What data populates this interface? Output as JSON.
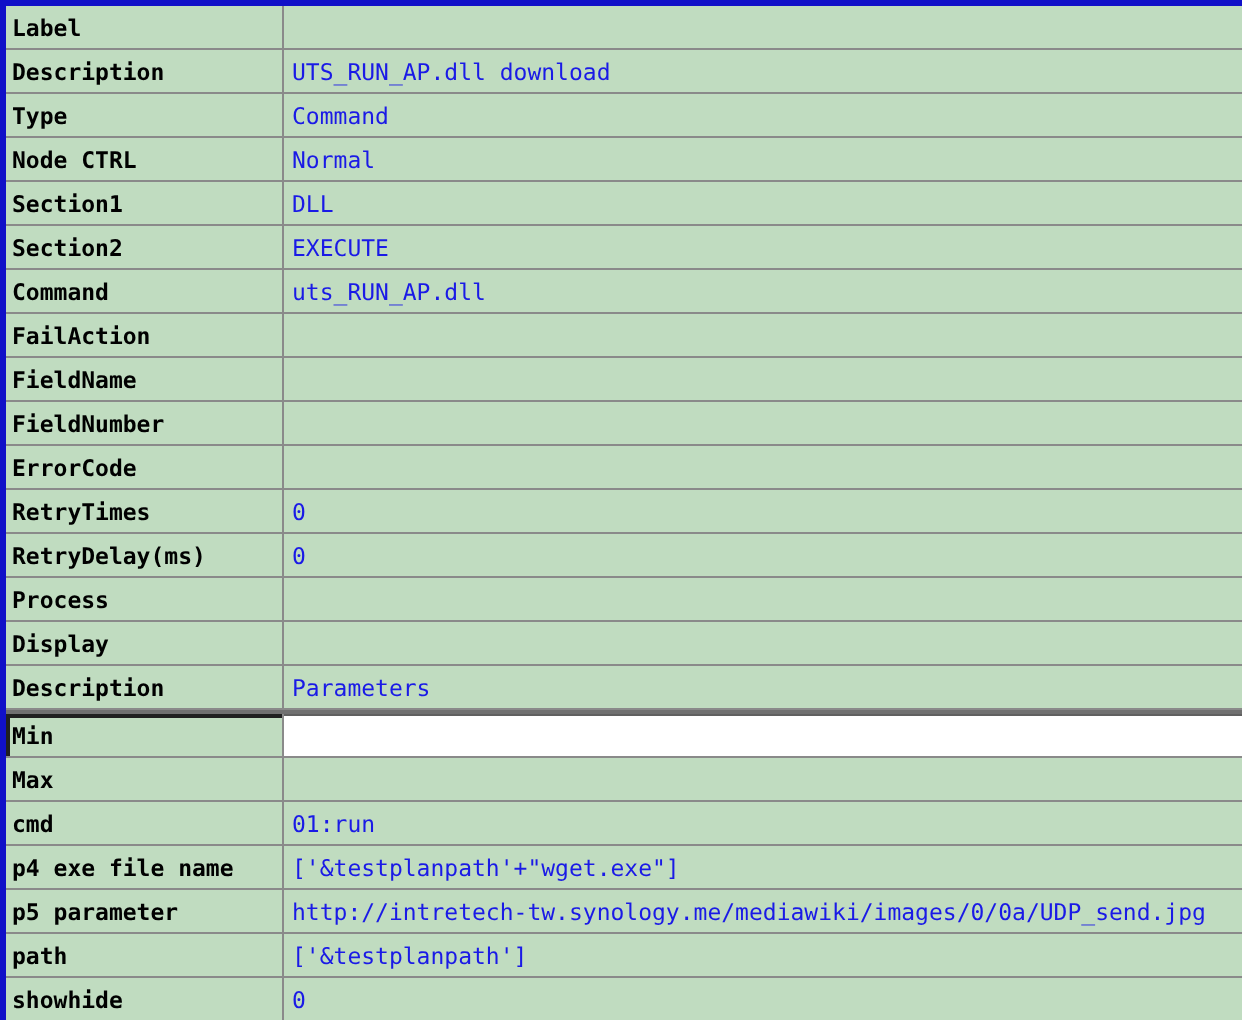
{
  "general": [
    {
      "label": "Label"
    },
    {
      "label": "Description",
      "value": "UTS_RUN_AP.dll download"
    },
    {
      "label": "Type",
      "value": "Command"
    },
    {
      "label": "Node CTRL",
      "value": "Normal"
    },
    {
      "label": "Section1",
      "value": "DLL"
    },
    {
      "label": "Section2",
      "value": "EXECUTE"
    },
    {
      "label": "Command",
      "value": "uts_RUN_AP.dll"
    },
    {
      "label": "FailAction"
    },
    {
      "label": "FieldName"
    },
    {
      "label": "FieldNumber"
    },
    {
      "label": "ErrorCode"
    },
    {
      "label": "RetryTimes",
      "value": "0"
    },
    {
      "label": "RetryDelay(ms)",
      "value": "0"
    },
    {
      "label": "Process"
    },
    {
      "label": "Display"
    },
    {
      "label": "Description",
      "value": "Parameters"
    }
  ],
  "parameters": [
    {
      "label": "Min",
      "editing": true
    },
    {
      "label": "Max",
      "editing": false
    },
    {
      "label": "cmd",
      "value": "01:run",
      "editing": false
    },
    {
      "label": "p4 exe file name",
      "value": "['&testplanpath'+\"wget.exe\"]",
      "editing": false
    },
    {
      "label": "p5 parameter",
      "value": "http://intretech-tw.synology.me/mediawiki/images/0/0a/UDP_send.jpg",
      "editing": false
    },
    {
      "label": "path",
      "value": "['&testplanpath']",
      "editing": false
    },
    {
      "label": "showhide",
      "value": "0",
      "editing": false
    }
  ]
}
